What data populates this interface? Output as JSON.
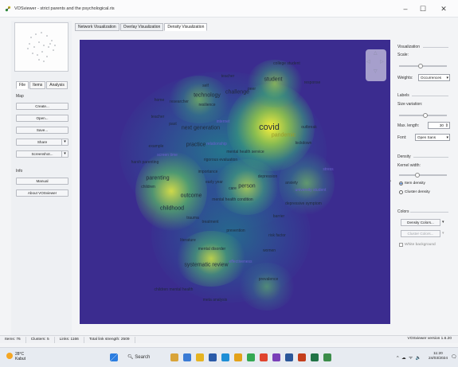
{
  "window": {
    "title": "VOSviewer - strict parents and the psychological.ris",
    "minimize": "–",
    "maximize": "☐",
    "close": "✕"
  },
  "left_panel": {
    "tabs": [
      "File",
      "Items",
      "Analysis"
    ],
    "map_label": "Map",
    "buttons": [
      "Create...",
      "Open...",
      "Save...",
      "Share",
      "Screenshot..."
    ],
    "info_label": "Info",
    "info_buttons": [
      "Manual",
      "About VOSviewer"
    ]
  },
  "view_tabs": [
    "Network Visualization",
    "Overlay Visualization",
    "Density Visualization"
  ],
  "map": {
    "terms": [
      "college student",
      "teacher",
      "student",
      "response",
      "self",
      "technology",
      "challenge",
      "peer",
      "resilience",
      "home",
      "researcher",
      "teacher",
      "past",
      "covid",
      "pandemic",
      "internet",
      "next generation",
      "outbreak",
      "example",
      "practice",
      "relationship",
      "lockdown",
      "mental health service",
      "screen time",
      "rigorous evaluation",
      "harsh parenting",
      "importance",
      "depression",
      "stress",
      "parenting",
      "early year",
      "care",
      "person",
      "anxiety",
      "children",
      "university student",
      "outcome",
      "mental health condition",
      "depressive symptom",
      "childhood",
      "barrier",
      "trauma",
      "treatment",
      "prevention",
      "risk factor",
      "literature",
      "mental disorder",
      "women",
      "systematic review",
      "effectiveness",
      "prevalence",
      "children mental health",
      "meta analysis",
      "learning",
      "age",
      "young people"
    ]
  },
  "right_panel": {
    "visualization_label": "Visualization",
    "scale_label": "Scale:",
    "weights_label": "Weights:",
    "weights_value": "Occurrences",
    "labels_label": "Labels",
    "size_variation_label": "Size variation:",
    "max_length_label": "Max. length:",
    "max_length_value": "30",
    "font_label": "Font:",
    "font_value": "Open Sans",
    "density_label": "Density",
    "kernel_width_label": "Kernel width:",
    "item_density_label": "Item density",
    "cluster_density_label": "Cluster density",
    "colors_label": "Colors",
    "density_colors_button": "Density Colors...",
    "cluster_colors_button": "Cluster Colors...",
    "white_background_label": "White background"
  },
  "status_bar": {
    "items": "Items: 76",
    "clusters": "Clusters: 5",
    "links": "Links: 1166",
    "total_link_strength": "Total link strength: 2509",
    "version": "VOSviewer version 1.6.20"
  },
  "taskbar": {
    "temperature": "28°C",
    "condition": "Kabut",
    "search_placeholder": "Search",
    "tray_icons": "^ ☁ ᯤ 🔈",
    "time": "11:20",
    "date": "24/03/2024"
  },
  "colors": {
    "map_background": "#3b2c8f",
    "density_peak": "#f4ee3c",
    "density_mid": "#3fb77e"
  }
}
